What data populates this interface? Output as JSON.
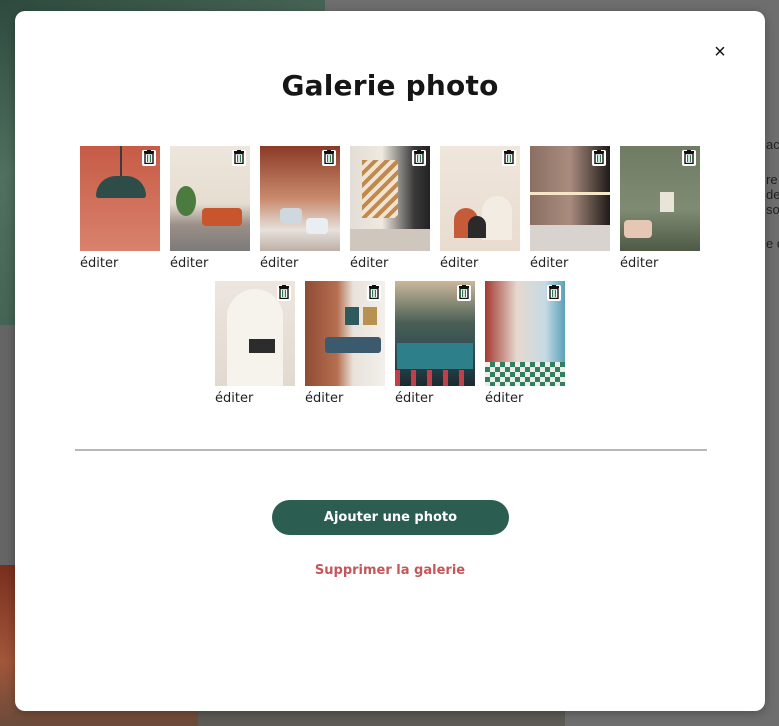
{
  "background": {
    "side_text_lines": [
      "acc",
      "re",
      "de",
      "so",
      "e d"
    ]
  },
  "modal": {
    "title": "Galerie photo",
    "close_symbol": "×",
    "gallery": {
      "rows": [
        [
          {
            "edit_label": "éditer"
          },
          {
            "edit_label": "éditer"
          },
          {
            "edit_label": "éditer"
          },
          {
            "edit_label": "éditer"
          },
          {
            "edit_label": "éditer"
          },
          {
            "edit_label": "éditer"
          },
          {
            "edit_label": "éditer"
          }
        ],
        [
          {
            "edit_label": "éditer"
          },
          {
            "edit_label": "éditer"
          },
          {
            "edit_label": "éditer"
          },
          {
            "edit_label": "éditer"
          }
        ]
      ]
    },
    "add_button_label": "Ajouter une photo",
    "delete_gallery_label": "Supprimer la galerie"
  },
  "colors": {
    "primary_button": "#2b5d51",
    "delete_link": "#c5575b"
  }
}
